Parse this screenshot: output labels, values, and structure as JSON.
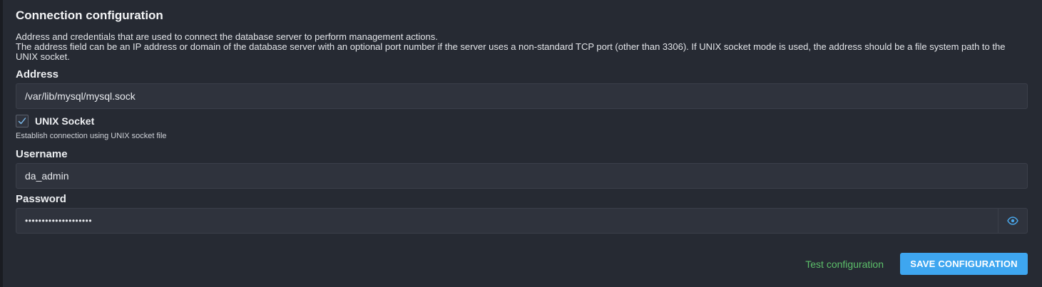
{
  "section": {
    "title": "Connection configuration",
    "description_line1": "Address and credentials that are used to connect the database server to perform management actions.",
    "description_line2": "The address field can be an IP address or domain of the database server with an optional port number if the server uses a non-standard TCP port (other than 3306). If UNIX socket mode is used, the address should be a file system path to the UNIX socket."
  },
  "address": {
    "label": "Address",
    "value": "/var/lib/mysql/mysql.sock"
  },
  "unix_socket": {
    "label": "UNIX Socket",
    "checked": true,
    "hint": "Establish connection using UNIX socket file"
  },
  "username": {
    "label": "Username",
    "value": "da_admin"
  },
  "password": {
    "label": "Password",
    "value": "••••••••••••••••••••",
    "toggle_icon": "eye-icon"
  },
  "actions": {
    "test_label": "Test configuration",
    "save_label": "SAVE CONFIGURATION"
  },
  "colors": {
    "accent": "#3ea6f0",
    "link_green": "#5cbf6a",
    "panel_bg": "#262a33"
  }
}
